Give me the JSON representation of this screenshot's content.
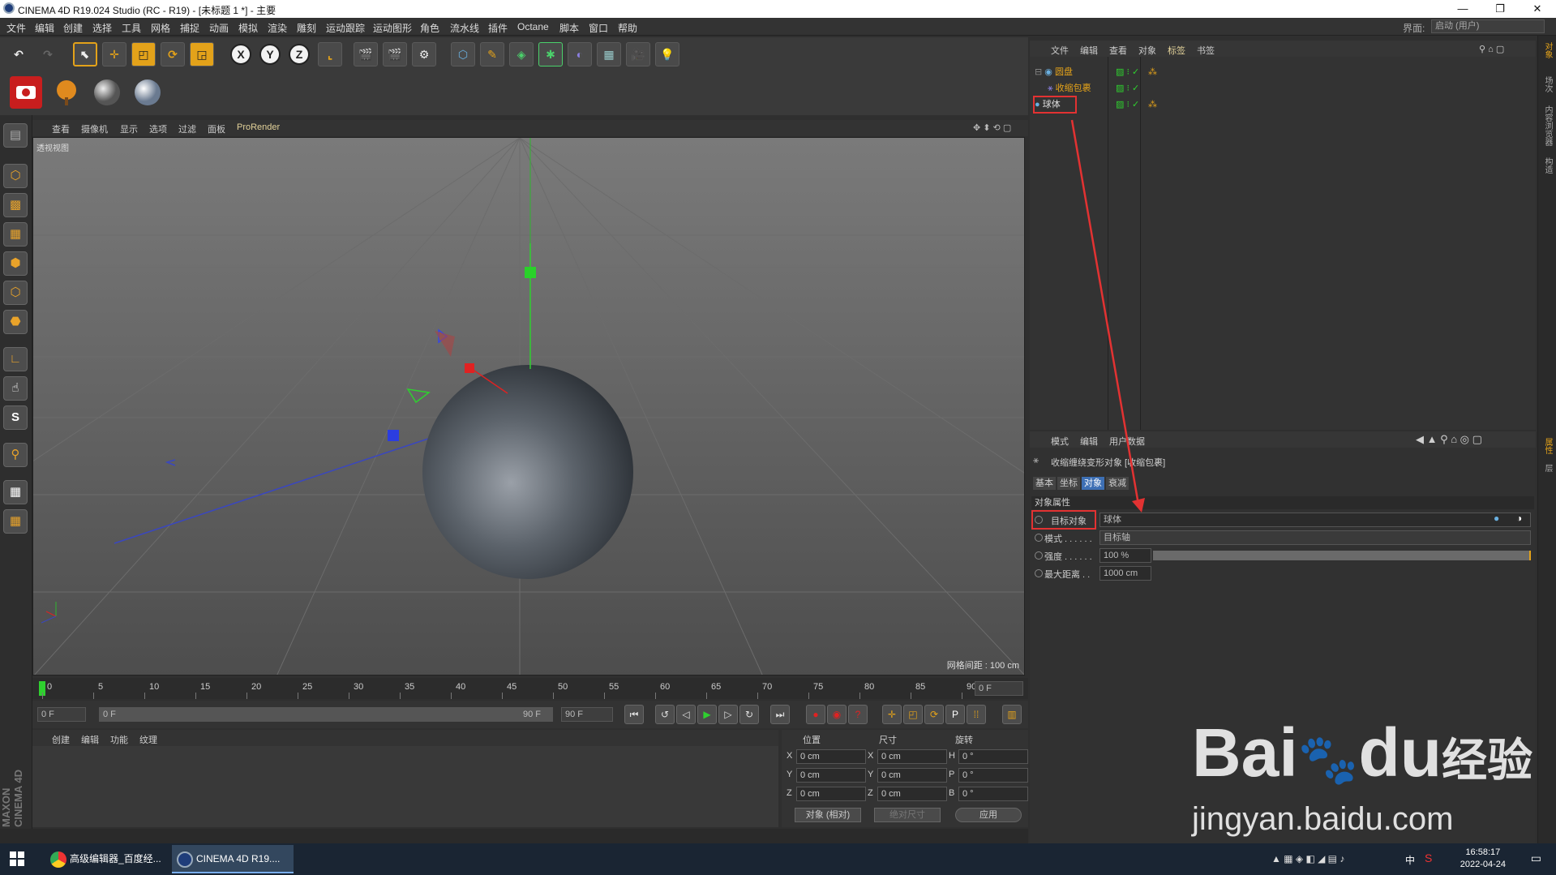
{
  "window": {
    "title": "CINEMA 4D R19.024 Studio (RC - R19) - [未标题 1 *] - 主要",
    "minimize": "—",
    "restore": "❐",
    "close": "✕"
  },
  "menubar": {
    "items": [
      "文件",
      "编辑",
      "创建",
      "选择",
      "工具",
      "网格",
      "捕捉",
      "动画",
      "模拟",
      "渲染",
      "雕刻",
      "运动跟踪",
      "运动图形",
      "角色",
      "流水线",
      "插件",
      "Octane",
      "脚本",
      "窗口",
      "帮助"
    ],
    "layout_label": "界面:",
    "layout_value": "启动 (用户)"
  },
  "toolbar": {
    "x_label": "X",
    "y_label": "Y",
    "z_label": "Z"
  },
  "viewport": {
    "menu": [
      "查看",
      "摄像机",
      "显示",
      "选项",
      "过滤",
      "面板",
      "ProRender"
    ],
    "label": "透视视图",
    "grid_spacing": "网格间距 : 100 cm"
  },
  "timeline": {
    "ticks": [
      "0",
      "5",
      "10",
      "15",
      "20",
      "25",
      "30",
      "35",
      "40",
      "45",
      "50",
      "55",
      "60",
      "65",
      "70",
      "75",
      "80",
      "85",
      "90"
    ],
    "current_frame": "0 F",
    "start": "0 F",
    "range_start": "0 F",
    "range_end": "90 F",
    "end": "90 F"
  },
  "material_manager": {
    "menu": [
      "创建",
      "编辑",
      "功能",
      "纹理"
    ]
  },
  "coordinates": {
    "headers": [
      "位置",
      "尺寸",
      "旋转"
    ],
    "rows": [
      {
        "pos_label": "X",
        "pos": "0 cm",
        "size_label": "X",
        "size": "0 cm",
        "rot_label": "H",
        "rot": "0 °"
      },
      {
        "pos_label": "Y",
        "pos": "0 cm",
        "size_label": "Y",
        "size": "0 cm",
        "rot_label": "P",
        "rot": "0 °"
      },
      {
        "pos_label": "Z",
        "pos": "0 cm",
        "size_label": "Z",
        "size": "0 cm",
        "rot_label": "B",
        "rot": "0 °"
      }
    ],
    "mode": "对象 (相对)",
    "size_mode": "绝对尺寸",
    "apply": "应用"
  },
  "object_manager": {
    "menu": [
      "文件",
      "编辑",
      "查看",
      "对象",
      "标签",
      "书签"
    ],
    "objects": [
      {
        "name": "圆盘"
      },
      {
        "name": "收缩包裹"
      },
      {
        "name": "球体"
      }
    ]
  },
  "attribute_manager": {
    "menu": [
      "模式",
      "编辑",
      "用户数据"
    ],
    "object_title": "收缩缠绕变形对象 [收缩包裹]",
    "tabs": [
      "基本",
      "坐标",
      "对象",
      "衰减"
    ],
    "section": "对象属性",
    "props": [
      {
        "label": "目标对象",
        "value": "球体"
      },
      {
        "label": "模式 . . . . . .",
        "value": "目标轴"
      },
      {
        "label": "强度 . . . . . .",
        "value": "100 %"
      },
      {
        "label": "最大距离 . .",
        "value": "1000 cm"
      }
    ],
    "strength": 1.0
  },
  "right_strip": [
    "对象",
    "场次",
    "内容浏览器",
    "构造",
    "属性",
    "层"
  ],
  "maxon": "MAXON CINEMA 4D",
  "taskbar": {
    "items": [
      "高级编辑器_百度经...",
      "CINEMA 4D R19...."
    ],
    "time": "16:58:17",
    "date": "2022-04-24",
    "ime": "中"
  },
  "watermark": {
    "brand": "Bai",
    "brand2": "du",
    "brand3": "经验",
    "url": "jingyan.baidu.com"
  },
  "colors": {
    "accent_orange": "#e3a21a",
    "selection_blue": "#3d6fb4",
    "annotation_red": "#e23232"
  }
}
